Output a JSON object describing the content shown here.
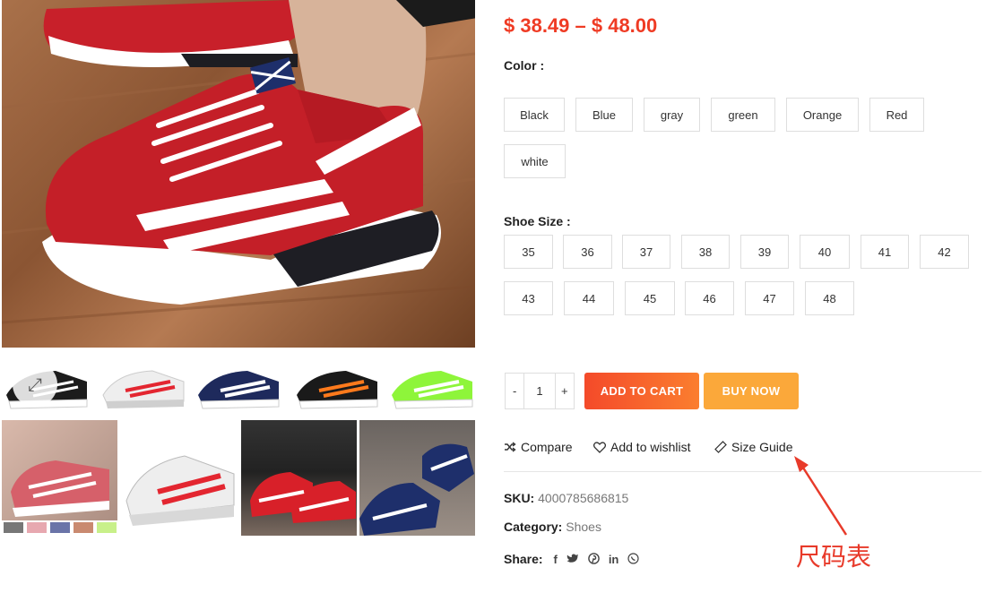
{
  "product": {
    "price_range": "$ 38.49 – $ 48.00"
  },
  "color": {
    "label": "Color :",
    "options": [
      "Black",
      "Blue",
      "gray",
      "green",
      "Orange",
      "Red",
      "white"
    ]
  },
  "size": {
    "label": "Shoe Size :",
    "options": [
      "35",
      "36",
      "37",
      "38",
      "39",
      "40",
      "41",
      "42",
      "43",
      "44",
      "45",
      "46",
      "47",
      "48"
    ]
  },
  "quantity": {
    "minus": "-",
    "value": "1",
    "plus": "+"
  },
  "buttons": {
    "add_to_cart": "ADD TO CART",
    "buy_now": "BUY NOW"
  },
  "actions": {
    "compare": "Compare",
    "wishlist": "Add to wishlist",
    "size_guide": "Size Guide"
  },
  "meta": {
    "sku_label": "SKU:",
    "sku_value": "4000785686815",
    "category_label": "Category:",
    "category_value": "Shoes",
    "share_label": "Share:"
  },
  "annotation": {
    "text": "尺码表"
  },
  "colors": {
    "price": "#ef3b24",
    "add_to_cart_start": "#f44a2a",
    "add_to_cart_end": "#fb7e2f",
    "buy_now": "#fba83a",
    "annotation": "#e83a2a"
  },
  "icons": [
    "expand-icon",
    "shuffle-icon",
    "heart-icon",
    "ruler-icon",
    "facebook-icon",
    "twitter-icon",
    "pinterest-icon",
    "linkedin-icon",
    "whatsapp-icon"
  ]
}
